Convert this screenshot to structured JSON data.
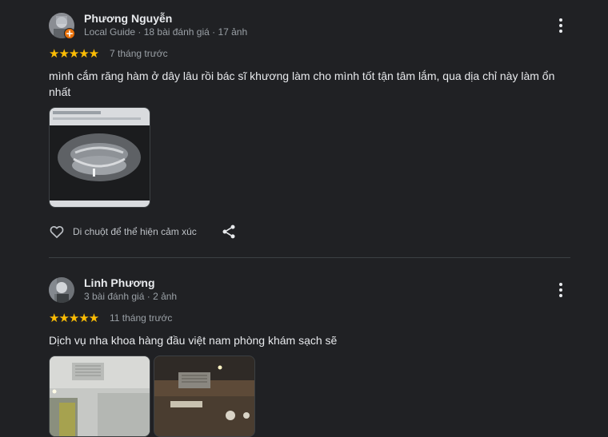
{
  "reviews": [
    {
      "author": "Phương Nguyễn",
      "meta": "Local Guide · 18 bài đánh giá · 17 ảnh",
      "stars": "★★★★★",
      "rating": 5,
      "time": "7 tháng trước",
      "text": "mình cắm răng hàm ở dây lâu rồi bác sĩ khương làm cho mình tốt tận tâm lắm, qua dịa chỉ này làm ổn nhất",
      "reaction_label": "Di chuột để thể hiện cảm xúc",
      "icons": {
        "more": "more-vert-icon",
        "heart": "heart-outline-icon",
        "share": "share-icon",
        "badge": "local-guide-badge-icon"
      }
    },
    {
      "author": "Linh Phương",
      "meta": "3 bài đánh giá · 2 ảnh",
      "stars": "★★★★★",
      "rating": 5,
      "time": "11 tháng trước",
      "text": "Dịch vụ nha khoa hàng đầu việt nam phòng khám sạch sẽ",
      "icons": {
        "more": "more-vert-icon"
      }
    }
  ],
  "colors": {
    "background": "#202124",
    "star": "#fbbc04",
    "text": "#e8eaed",
    "muted": "#9aa0a6",
    "divider": "#3c4043",
    "badge": "#e8710a"
  }
}
